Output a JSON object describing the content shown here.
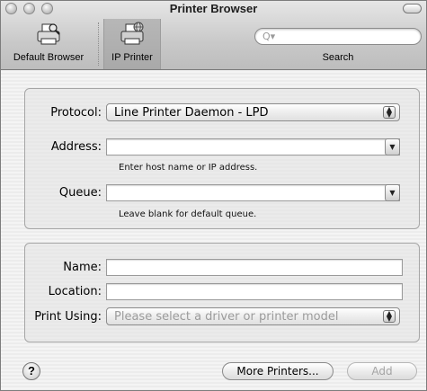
{
  "window": {
    "title": "Printer Browser"
  },
  "toolbar": {
    "default_browser_label": "Default Browser",
    "ip_printer_label": "IP Printer",
    "search_placeholder": "",
    "search_label": "Search",
    "selected": "IP Printer"
  },
  "connection": {
    "protocol_label": "Protocol:",
    "protocol_value": "Line Printer Daemon - LPD",
    "address_label": "Address:",
    "address_value": "",
    "address_hint": "Enter host name or IP address.",
    "queue_label": "Queue:",
    "queue_value": "",
    "queue_hint": "Leave blank for default queue."
  },
  "details": {
    "name_label": "Name:",
    "name_value": "",
    "location_label": "Location:",
    "location_value": "",
    "print_using_label": "Print Using:",
    "print_using_value": "Please select a driver or printer model"
  },
  "footer": {
    "help_label": "?",
    "more_printers_label": "More Printers...",
    "add_label": "Add"
  },
  "colors": {
    "selected_tab_bg": "#ababab",
    "disabled_text": "#9b9b9b"
  }
}
